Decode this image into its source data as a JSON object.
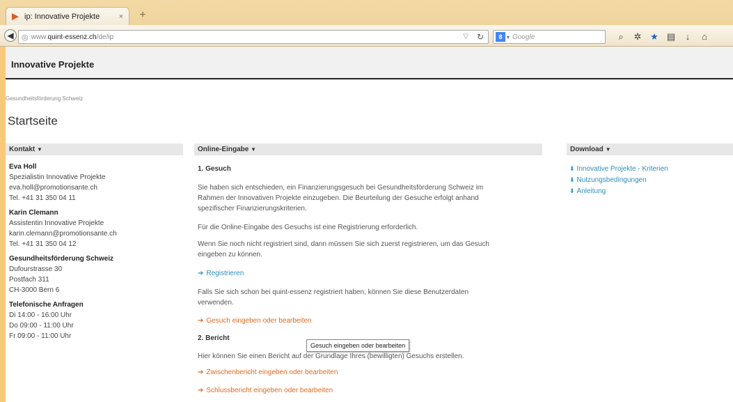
{
  "browser": {
    "tab_title": "ip: Innovative Projekte",
    "tab_close": "×",
    "new_tab": "+",
    "url_prefix": "www.",
    "url_domain": "quint-essenz.ch",
    "url_path": "/de/ip",
    "search_placeholder": "Google",
    "search_engine_badge": "8"
  },
  "site": {
    "title": "Innovative Projekte",
    "breadcrumb": "Gesundheitsförderung Schweiz",
    "page_title": "Startseite"
  },
  "contact": {
    "heading": "Kontakt",
    "persons": [
      {
        "name": "Eva Holl",
        "role": "Spezialistin Innovative Projekte",
        "email": "eva.holl@promotionsante.ch",
        "tel": "Tel. +41 31 350 04 11"
      },
      {
        "name": "Karin Clemann",
        "role": "Assistentin Innovative Projekte",
        "email": "karin.clemann@promotionsante.ch",
        "tel": "Tel. +41 31 350 04 12"
      }
    ],
    "org": {
      "name": "Gesundheitsförderung Schweiz",
      "street": "Dufourstrasse 30",
      "postbox": "Postfach 311",
      "city": "CH-3000 Bern 6"
    },
    "phone": {
      "title": "Telefonische Anfragen",
      "hours": [
        "Di 14:00 - 16:00 Uhr",
        "Do 09:00 - 11:00 Uhr",
        "Fr 09:00 - 11:00 Uhr"
      ]
    }
  },
  "main": {
    "heading": "Online-Eingabe",
    "section1_title": "1. Gesuch",
    "p1_line1": "Sie haben sich entschieden, ein Finanzierungsgesuch bei Gesundheitsförderung Schweiz im",
    "p1_line2": "Rahmen der Innovativen Projekte einzugeben. Die Beurteilung der Gesuche erfolgt anhand",
    "p1_line3": "spezifischer Finanzierungskriterien.",
    "p2": "Für die Online-Eingabe des Gesuchs ist eine Registrierung erforderlich.",
    "p3_line1": "Wenn Sie noch nicht registriert sind, dann müssen Sie sich zuerst registrieren, um das Gesuch",
    "p3_line2": "eingeben zu können.",
    "register_link": "Registrieren",
    "p4_line1": "Falls Sie sich schon bei quint-essenz registriert haben, können Sie diese Benutzerdaten",
    "p4_line2": "verwenden.",
    "gesuch_link": "Gesuch eingeben oder bearbeiten",
    "section2_title": "2. Bericht",
    "p5": "Hier können Sie einen Bericht auf der Grundlage Ihres (bewilligten) Gesuchs erstellen.",
    "zwischen_link": "Zwischenbericht eingeben oder bearbeiten",
    "schluss_link": "Schlussbericht eingeben oder bearbeiten",
    "tooltip": "Gesuch eingeben oder bearbeiten"
  },
  "download": {
    "heading": "Download",
    "links": [
      "Innovative Projekte - Kriterien",
      "Nutzungsbedingungen",
      "Anleitung"
    ]
  },
  "colors": {
    "link_blue": "#2a8fbd",
    "link_orange": "#e06a1f",
    "frame": "#f7c97a"
  }
}
